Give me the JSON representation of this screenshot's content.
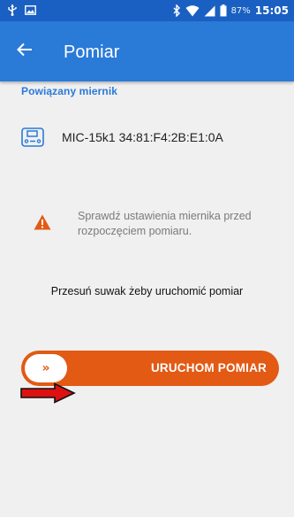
{
  "status_bar": {
    "battery": "87%",
    "time": "15:05",
    "icons": [
      "usb-icon",
      "image-notification-icon",
      "bluetooth-icon",
      "wifi-icon",
      "cellular-icon",
      "battery-icon"
    ]
  },
  "app_bar": {
    "title": "Pomiar",
    "back_icon": "arrow-left-icon",
    "color": "#2a7ad8"
  },
  "linked_meter": {
    "section_label": "Powiązany miernik",
    "device_name": "MIC-15k1 34:81:F4:2B:E1:0A",
    "device_icon": "meter-device-icon"
  },
  "warning": {
    "icon": "warning-triangle-icon",
    "text": "Sprawdź ustawienia miernika przed rozpoczęciem pomiaru.",
    "color": "#e25a14"
  },
  "slide_hint": "Przesuń suwak żeby uruchomić pomiar",
  "slider": {
    "knob_symbol": "»",
    "label": "URUCHOM POMIAR",
    "color": "#e25a14"
  },
  "annotation": {
    "icon": "red-arrow-icon",
    "color": "#dd1111"
  }
}
